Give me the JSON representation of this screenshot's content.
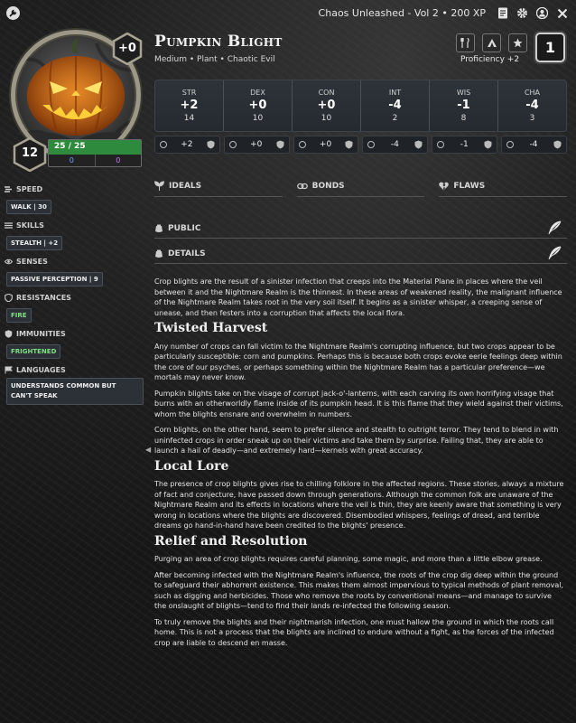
{
  "titlebar": {
    "title": "Chaos Unleashed - Vol 2 • 200 XP"
  },
  "header": {
    "name": "Pumpkin Blight",
    "subtitle": "Medium • Plant • Chaotic Evil",
    "proficiency": "Proficiency +2",
    "proficiency_box": "1",
    "portrait_badge": "+0"
  },
  "level": "12",
  "hp": {
    "current": "25 / 25",
    "temp": "0",
    "max_mod": "0"
  },
  "abilities": [
    {
      "name": "STR",
      "mod": "+2",
      "score": "14",
      "save": "+2"
    },
    {
      "name": "DEX",
      "mod": "+0",
      "score": "10",
      "save": "+0"
    },
    {
      "name": "CON",
      "mod": "+0",
      "score": "10",
      "save": "+0"
    },
    {
      "name": "INT",
      "mod": "-4",
      "score": "2",
      "save": "-4"
    },
    {
      "name": "WIS",
      "mod": "-1",
      "score": "8",
      "save": "-1"
    },
    {
      "name": "CHA",
      "mod": "-4",
      "score": "3",
      "save": "-4"
    }
  ],
  "sidebar": {
    "speed": {
      "label": "SPEED",
      "value": "WALK | 30"
    },
    "skills": {
      "label": "SKILLS",
      "value": "STEALTH | +2"
    },
    "senses": {
      "label": "SENSES",
      "value": "PASSIVE PERCEPTION | 9"
    },
    "resistances": {
      "label": "RESISTANCES",
      "value": "FIRE"
    },
    "immunities": {
      "label": "IMMUNITIES",
      "value": "FRIGHTENED"
    },
    "languages": {
      "label": "LANGUAGES",
      "value": "UNDERSTANDS COMMON BUT CAN'T SPEAK"
    }
  },
  "tabs": {
    "ideals": "IDEALS",
    "bonds": "BONDS",
    "flaws": "FLAWS"
  },
  "sections": {
    "public": "PUBLIC",
    "details": "DETAILS"
  },
  "content": {
    "intro": "Crop blights are the result of a sinister infection that creeps into the Material Plane in places where the veil between it and the Nightmare Realm is the thinnest. In these areas of weakened reality, the malignant influence of the Nightmare Realm takes root in the very soil itself. It begins as a sinister whisper, a creeping sense of unease, and then festers into a corruption that affects the local flora.",
    "h1": "Twisted Harvest",
    "p1": "Any number of crops can fall victim to the Nightmare Realm's corrupting influence, but two crops appear to be particularly susceptible: corn and pumpkins. Perhaps this is because both crops evoke eerie feelings deep within the core of our psyches, or perhaps something within the Nightmare Realm has a particular preference—we mortals may never know.",
    "p2": "Pumpkin blights take on the visage of corrupt jack-o'-lanterns, with each carving its own horrifying visage that burns with an otherworldly flame inside of its pumpkin head. It is this flame that they wield against their victims, whom the blights ensnare and overwhelm in numbers.",
    "p3": "Corn blights, on the other hand, seem to prefer silence and stealth to outright terror. They tend to blend in with uninfected crops in order sneak up on their victims and take them by surprise. Failing that, they are able to launch a hail of deadly—and extremely hard—kernels with great accuracy.",
    "h2": "Local Lore",
    "p4": "The presence of crop blights gives rise to chilling folklore in the affected regions. These stories, always a mixture of fact and conjecture, have passed down through generations. Although the common folk are unaware of the Nightmare Realm and its effects in locations where the veil is thin, they are keenly aware that something is very wrong in locations where the blights are discovered. Disembodied whispers, feelings of dread, and terrible dreams go hand-in-hand have been credited to the blights' presence.",
    "h3": "Relief and Resolution",
    "p5": "Purging an area of crop blights requires careful planning, some magic, and more than a little elbow grease.",
    "p6": "After becoming infected with the Nightmare Realm's influence, the roots of the crop dig deep within the ground to safeguard their abhorrent existence. This makes them almost impervious to typical methods of plant removal, such as digging and herbicides. Those who remove the roots by conventional means—and manage to survive the onslaught of blights—tend to find their lands re-infected the following season.",
    "p7": "To truly remove the blights and their nightmarish infection, one must hallow the ground in which the roots call home. This is not a process that the blights are inclined to endure without a fight, as the forces of the infected crop are liable to descend en masse."
  }
}
